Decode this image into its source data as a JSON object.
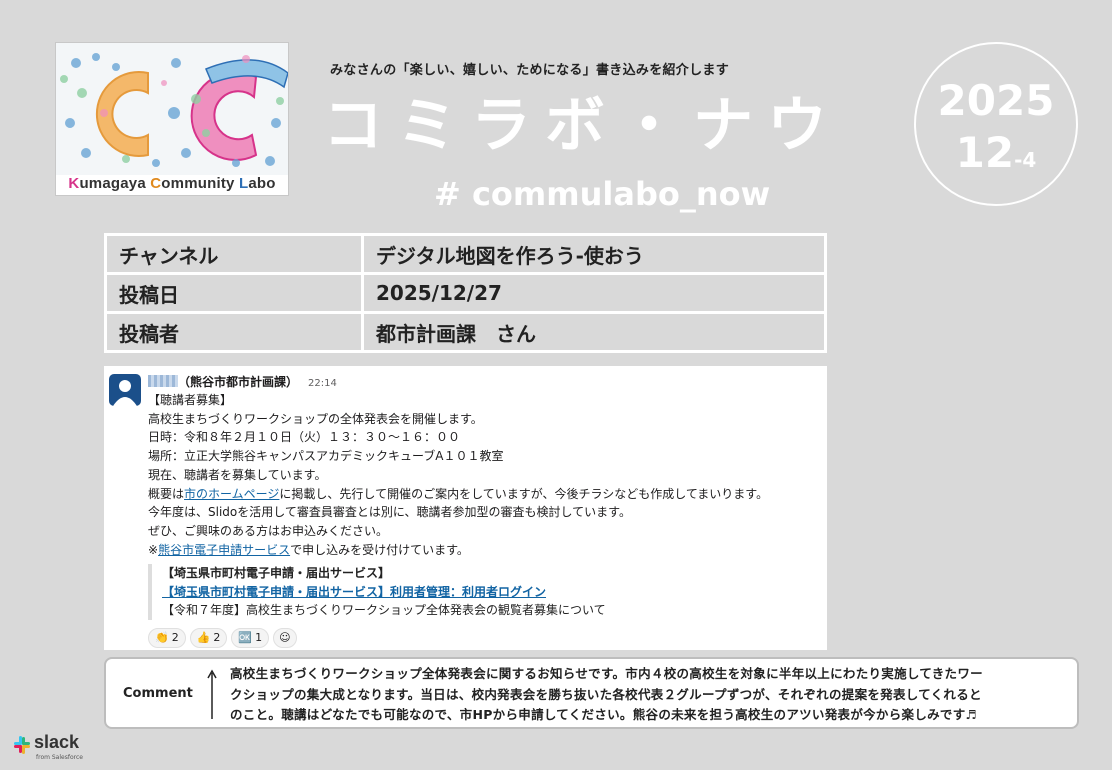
{
  "logo": {
    "k": "K",
    "k_rest": "umagaya ",
    "c": "C",
    "c_rest": "ommunity ",
    "l": "L",
    "l_rest": "abo"
  },
  "header": {
    "subtitle": "みなさんの「楽しい、嬉しい、ためになる」書き込みを紹介します",
    "title": "コミラボ・ナウ",
    "hashtag": "# commulabo_now"
  },
  "date_badge": {
    "year": "2025",
    "month_day": "12",
    "suffix": "-4"
  },
  "info": {
    "channel_label": "チャンネル",
    "channel_value": "デジタル地図を作ろう-使おう",
    "date_label": "投稿日",
    "date_value": "2025/12/27",
    "author_label": "投稿者",
    "author_value": "都市計画課　さん"
  },
  "post": {
    "author_org": "（熊谷市都市計画課）",
    "time": "22:14",
    "lines": {
      "l1": "【聴講者募集】",
      "l2": "高校生まちづくりワークショップの全体発表会を開催します。",
      "l3": "日時：令和８年２月１０日（火）１３：３０〜１６：００",
      "l4": "場所：立正大学熊谷キャンパスアカデミックキューブA１０１教室",
      "l5": "現在、聴講者を募集しています。",
      "l6a": "概要は",
      "l6link": "市のホームページ",
      "l6b": "に掲載し、先行して開催のご案内をしていますが、今後チラシなども作成してまいります。",
      "l7": "今年度は、Slidoを活用して審査員審査とは別に、聴講者参加型の審査も検討しています。",
      "l8": "ぜひ、ご興味のある方はお申込みください。",
      "l9a": "※",
      "l9link": "熊谷市電子申請サービス",
      "l9b": "で申し込みを受け付けています。"
    },
    "quote": {
      "title": "【埼玉県市町村電子申請・届出サービス】",
      "link": "【埼玉県市町村電子申請・届出サービス】利用者管理：利用者ログイン",
      "desc": "【令和７年度】高校生まちづくりワークショップ全体発表会の観覧者募集について"
    },
    "reactions": [
      {
        "emoji": "👏",
        "count": "2"
      },
      {
        "emoji": "👍",
        "count": "2"
      },
      {
        "emoji": "🆗",
        "count": "1"
      }
    ],
    "add_reaction": "☺"
  },
  "comment": {
    "label": "Comment",
    "line1": "高校生まちづくりワークショップ全体発表会に関するお知らせです。市内４校の高校生を対象に半年以上にわたり実施してきたワー",
    "line2": "クショップの集大成となります。当日は、校内発表会を勝ち抜いた各校代表２グループずつが、それぞれの提案を発表してくれると",
    "line3": "のこと。聴講はどなたでも可能なので、市HPから申請してください。熊谷の未来を担う高校生のアツい発表が今から楽しみです♬"
  },
  "footer": {
    "brand": "slack",
    "from": "from Salesforce"
  },
  "colors": {
    "background": "#d9d9d9",
    "link": "#1264a3",
    "logo_k": "#d6338a",
    "logo_c": "#e08a1e",
    "logo_l": "#2e6fb5"
  }
}
